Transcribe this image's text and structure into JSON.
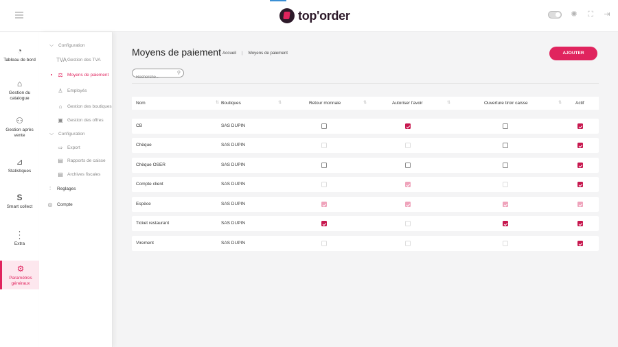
{
  "app": {
    "logo_text": "top'order"
  },
  "colors": {
    "accent": "#e0245e",
    "checkbox_checked": "#c7174e",
    "checkbox_disabled_checked": "#efa3bb"
  },
  "rail": {
    "items": [
      {
        "label": "Tableau de bord",
        "icon": "dashboard-icon"
      },
      {
        "label": "Gestion du catalogue",
        "icon": "catalog-icon"
      },
      {
        "label": "Gestion après vente",
        "icon": "after-sales-icon"
      },
      {
        "label": "Statistiques",
        "icon": "statistics-icon"
      },
      {
        "label": "Smart collect",
        "icon": "smart-collect-icon"
      },
      {
        "label": "Extra",
        "icon": "more-icon"
      },
      {
        "label": "Paramètres généraux",
        "icon": "settings-sliders-icon",
        "active": true
      }
    ]
  },
  "submenu": {
    "items": [
      {
        "label": "Configuration",
        "icon": "chevron-down-icon",
        "kind": "section"
      },
      {
        "label": "Gestion des TVA",
        "icon": "tva-icon"
      },
      {
        "label": "Moyens de paiement",
        "icon": "payment-icon",
        "active": true
      },
      {
        "label": "Employés",
        "icon": "employee-icon"
      },
      {
        "label": "Gestion des boutiques",
        "icon": "store-icon"
      },
      {
        "label": "Gestion des offres",
        "icon": "offers-icon"
      },
      {
        "label": "Configuration",
        "icon": "chevron-down-icon",
        "kind": "section"
      },
      {
        "label": "Export",
        "icon": "export-icon"
      },
      {
        "label": "Rapports de caisse",
        "icon": "report-icon"
      },
      {
        "label": "Archives fiscales",
        "icon": "archive-icon"
      },
      {
        "label": "Reglages",
        "icon": "sliders-icon",
        "dark": true
      },
      {
        "label": "Compte",
        "icon": "account-icon",
        "dark": true
      }
    ]
  },
  "page": {
    "title": "Moyens de paiement",
    "breadcrumb": [
      "Accueil",
      "Moyens de paiement"
    ],
    "add_button": "AJOUTER",
    "search_placeholder": "Recherche..."
  },
  "table": {
    "columns": [
      "Nom",
      "Boutiques",
      "Retour monnaie",
      "Autoriser l'avoir",
      "Ouverture tiroir caisse",
      "Actif"
    ],
    "rows": [
      {
        "name": "CB",
        "shop": "SAS DUPIN",
        "cells": [
          [
            "off",
            "en"
          ],
          [
            "on",
            "en"
          ],
          [
            "off",
            "en"
          ],
          [
            "on",
            "en"
          ]
        ]
      },
      {
        "name": "Chèque",
        "shop": "SAS DUPIN",
        "cells": [
          [
            "off",
            "dis"
          ],
          [
            "off",
            "dis"
          ],
          [
            "off",
            "en"
          ],
          [
            "on",
            "en"
          ]
        ]
      },
      {
        "name": "Chèque OSER",
        "shop": "SAS DUPIN",
        "cells": [
          [
            "off",
            "en"
          ],
          [
            "off",
            "en"
          ],
          [
            "off",
            "en"
          ],
          [
            "on",
            "en"
          ]
        ]
      },
      {
        "name": "Compte client",
        "shop": "SAS DUPIN",
        "cells": [
          [
            "off",
            "dis"
          ],
          [
            "on",
            "dis"
          ],
          [
            "off",
            "dis"
          ],
          [
            "on",
            "en"
          ]
        ]
      },
      {
        "name": "Espèce",
        "shop": "SAS DUPIN",
        "cells": [
          [
            "on",
            "dis"
          ],
          [
            "on",
            "dis"
          ],
          [
            "on",
            "dis"
          ],
          [
            "on",
            "dis"
          ]
        ]
      },
      {
        "name": "Ticket restaurant",
        "shop": "SAS DUPIN",
        "cells": [
          [
            "on",
            "en"
          ],
          [
            "off",
            "dis"
          ],
          [
            "on",
            "en"
          ],
          [
            "on",
            "en"
          ]
        ]
      },
      {
        "name": "Virement",
        "shop": "SAS DUPIN",
        "cells": [
          [
            "off",
            "dis"
          ],
          [
            "off",
            "dis"
          ],
          [
            "off",
            "dis"
          ],
          [
            "on",
            "en"
          ]
        ]
      }
    ]
  }
}
